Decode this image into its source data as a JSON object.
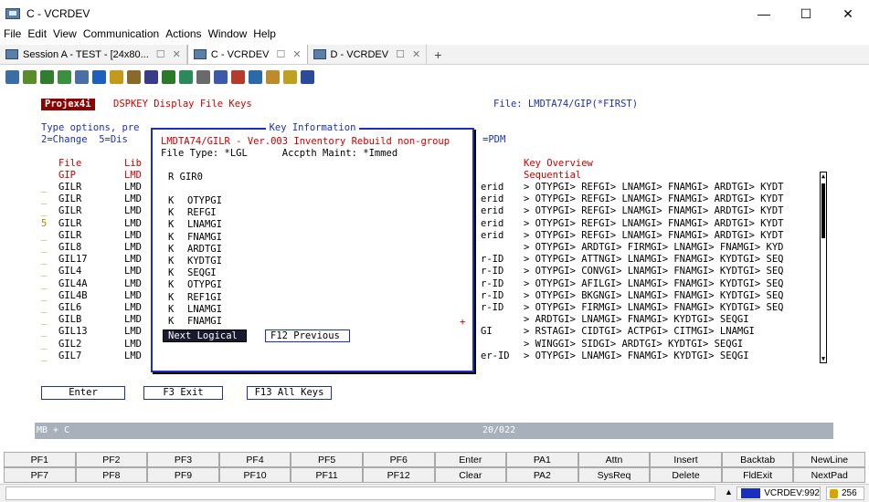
{
  "window": {
    "title": "C - VCRDEV",
    "minimize": "—",
    "maximize": "☐",
    "close": "✕"
  },
  "menu": [
    "File",
    "Edit",
    "View",
    "Communication",
    "Actions",
    "Window",
    "Help"
  ],
  "tabs": [
    {
      "label": "Session A - TEST - [24x80...",
      "active": false
    },
    {
      "label": "C - VCRDEV",
      "active": true
    },
    {
      "label": "D - VCRDEV",
      "active": false
    }
  ],
  "tab_add": "+",
  "toolbar_colors": [
    "#3a6ea5",
    "#5b8c2a",
    "#2f7d2f",
    "#3c8f3c",
    "#4a6fa5",
    "#1f5fbf",
    "#c49a1a",
    "#8a6a2a",
    "#3a3a8a",
    "#2a7a2a",
    "#2a8a5a",
    "#6a6a6a",
    "#3a5aaa",
    "#b83a2a",
    "#2a6aaa",
    "#c08a2a",
    "#c0a020",
    "#2a4a9a"
  ],
  "screen": {
    "brand": "Projex4i",
    "command": "DSPKEY Display File Keys",
    "file_info": "File: LMDTA74/GIP(*FIRST)",
    "type_options_1": "Type options, pre",
    "type_options_2": "2=Change  5=Dis",
    "pdm_tag": "=PDM",
    "col_file": "File",
    "col_lib": "Lib",
    "col_key_overview": "Key Overview",
    "first_row": {
      "file": "GIP",
      "lib": "LMD",
      "overview": "Sequential"
    },
    "rows": [
      {
        "file": "GILR",
        "lib": "LMD",
        "mid": "erid",
        "overview": "> OTYPGI> REFGI> LNAMGI> FNAMGI> ARDTGI> KYDT"
      },
      {
        "file": "GILR",
        "lib": "LMD",
        "mid": "erid",
        "overview": "> OTYPGI> REFGI> LNAMGI> FNAMGI> ARDTGI> KYDT"
      },
      {
        "file": "GILR",
        "lib": "LMD",
        "mid": "erid",
        "overview": "> OTYPGI> REFGI> LNAMGI> FNAMGI> ARDTGI> KYDT"
      },
      {
        "file": "GILR",
        "lib": "LMD",
        "mid": "erid",
        "overview": "> OTYPGI> REFGI> LNAMGI> FNAMGI> ARDTGI> KYDT"
      },
      {
        "file": "GILR",
        "lib": "LMD",
        "mid": "erid",
        "overview": "> OTYPGI> REFGI> LNAMGI> FNAMGI> ARDTGI> KYDT"
      },
      {
        "file": "GIL8",
        "lib": "LMD",
        "mid": "",
        "overview": "> OTYPGI> ARDTGI> FIRMGI> LNAMGI> FNAMGI> KYD"
      },
      {
        "file": "GIL17",
        "lib": "LMD",
        "mid": "r-ID",
        "overview": "> OTYPGI> ATTNGI> LNAMGI> FNAMGI> KYDTGI> SEQ"
      },
      {
        "file": "GIL4",
        "lib": "LMD",
        "mid": "r-ID",
        "overview": "> OTYPGI> CONVGI> LNAMGI> FNAMGI> KYDTGI> SEQ"
      },
      {
        "file": "GIL4A",
        "lib": "LMD",
        "mid": "r-ID",
        "overview": "> OTYPGI> AFILGI> LNAMGI> FNAMGI> KYDTGI> SEQ"
      },
      {
        "file": "GIL4B",
        "lib": "LMD",
        "mid": "r-ID",
        "overview": "> OTYPGI> BKGNGI> LNAMGI> FNAMGI> KYDTGI> SEQ"
      },
      {
        "file": "GIL6",
        "lib": "LMD",
        "mid": "r-ID",
        "overview": "> OTYPGI> FIRMGI> LNAMGI> FNAMGI> KYDTGI> SEQ"
      },
      {
        "file": "GILB",
        "lib": "LMD",
        "mid": "",
        "overview": "> ARDTGI> LNAMGI> FNAMGI> KYDTGI> SEQGI"
      },
      {
        "file": "GIL13",
        "lib": "LMD",
        "mid": "GI",
        "overview": "> RSTAGI> CIDTGI> ACTPGI> CITMGI> LNAMGI"
      },
      {
        "file": "GIL2",
        "lib": "LMD",
        "mid": "",
        "overview": "> WINGGI> SIDGI> ARDTGI> KYDTGI> SEQGI"
      },
      {
        "file": "GIL7",
        "lib": "LMD",
        "mid": "er-ID",
        "overview": "> OTYPGI> LNAMGI> FNAMGI> KYDTGI> SEQGI"
      }
    ],
    "row_markers": [
      "_",
      "_",
      "_",
      "5",
      "_",
      "_",
      "_",
      "_",
      "_",
      "_",
      "_",
      "_",
      "_",
      "_",
      "_"
    ],
    "buttons": {
      "enter": "Enter",
      "exit": "F3 Exit",
      "all_keys": "F13 All Keys"
    },
    "status_left": "MB  +  C",
    "status_pos": "20/022"
  },
  "popup": {
    "title": "Key Information",
    "line1": "LMDTA74/GILR - Ver.003 Inventory Rebuild non-group",
    "line2": "File Type: *LGL      Accpth Maint: *Immed",
    "record": "R GIR0",
    "keys": [
      {
        "type": "K",
        "name": "OTYPGI"
      },
      {
        "type": "K",
        "name": "REFGI"
      },
      {
        "type": "K",
        "name": "LNAMGI"
      },
      {
        "type": "K",
        "name": "FNAMGI"
      },
      {
        "type": "K",
        "name": "ARDTGI"
      },
      {
        "type": "K",
        "name": "KYDTGI"
      },
      {
        "type": "K",
        "name": "SEQGI"
      },
      {
        "type": "K",
        "name": "OTYPGI"
      },
      {
        "type": "K",
        "name": "REF1GI"
      },
      {
        "type": "K",
        "name": "LNAMGI"
      },
      {
        "type": "K",
        "name": "FNAMGI"
      }
    ],
    "more": "+",
    "btn_next": "Next Logical",
    "btn_prev": "F12 Previous"
  },
  "keypad": {
    "row1": [
      "PF1",
      "PF2",
      "PF3",
      "PF4",
      "PF5",
      "PF6",
      "Enter",
      "PA1",
      "Attn",
      "Insert",
      "Backtab",
      "NewLine"
    ],
    "row2": [
      "PF7",
      "PF8",
      "PF9",
      "PF10",
      "PF11",
      "PF12",
      "Clear",
      "PA2",
      "SysReq",
      "Delete",
      "FldExit",
      "NextPad"
    ]
  },
  "statusbar": {
    "session": "VCRDEV:992",
    "count": "256",
    "scroll_up": "▲"
  }
}
